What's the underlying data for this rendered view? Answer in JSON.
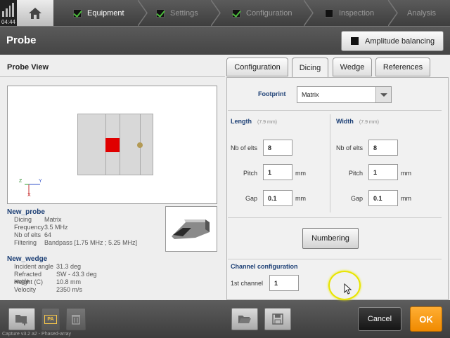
{
  "status": {
    "clock": "04:44"
  },
  "nav": {
    "steps": [
      {
        "label": "Equipment",
        "checked": true
      },
      {
        "label": "Settings",
        "checked": true
      },
      {
        "label": "Configuration",
        "checked": true
      },
      {
        "label": "Inspection",
        "checked": false
      },
      {
        "label": "Analysis"
      }
    ]
  },
  "header": {
    "title": "Probe",
    "amp_label": "Amplitude balancing"
  },
  "probe_view": {
    "title": "Probe View",
    "axes": {
      "z": "Z",
      "y": "Y",
      "x": "X"
    },
    "probe": {
      "name": "New_probe",
      "rows": [
        {
          "k": "Dicing",
          "v": "Matrix"
        },
        {
          "k": "Frequency",
          "v": "3.5 MHz"
        },
        {
          "k": "Nb of elts",
          "v": "64"
        },
        {
          "k": "Filtering",
          "v": "Bandpass [1.75 MHz ; 5.25 MHz]"
        }
      ]
    },
    "wedge": {
      "name": "New_wedge",
      "rows": [
        {
          "k": "Incident angle",
          "v": "31.3 deg"
        },
        {
          "k": "Refracted angle",
          "v": "SW - 43.3 deg"
        },
        {
          "k": "Height (C)",
          "v": "10.8 mm"
        },
        {
          "k": "Velocity",
          "v": "2350 m/s"
        }
      ]
    }
  },
  "tabs": [
    "Configuration",
    "Dicing",
    "Wedge",
    "References"
  ],
  "dicing": {
    "footprint_label": "Footprint",
    "footprint_value": "Matrix",
    "length": {
      "title": "Length",
      "hint": "(7.9 mm)",
      "nb_label": "Nb of elts",
      "nb": "8",
      "pitch_label": "Pitch",
      "pitch": "1",
      "gap_label": "Gap",
      "gap": "0.1",
      "unit": "mm"
    },
    "width": {
      "title": "Width",
      "hint": "(7.9 mm)",
      "nb_label": "Nb of elts",
      "nb": "8",
      "pitch_label": "Pitch",
      "pitch": "1",
      "gap_label": "Gap",
      "gap": "0.1",
      "unit": "mm"
    },
    "numbering": "Numbering",
    "channel_title": "Channel configuration",
    "first_channel_label": "1st channel",
    "first_channel": "1"
  },
  "bottom": {
    "pa_label": "PA",
    "cancel": "Cancel",
    "ok": "OK",
    "footer": "Capture v3.2 a2 - Phased-array"
  },
  "colors": {
    "accent_ok": "#f39200",
    "check": "#4cba3c",
    "element": "#e00000",
    "section": "#1c3f75"
  }
}
